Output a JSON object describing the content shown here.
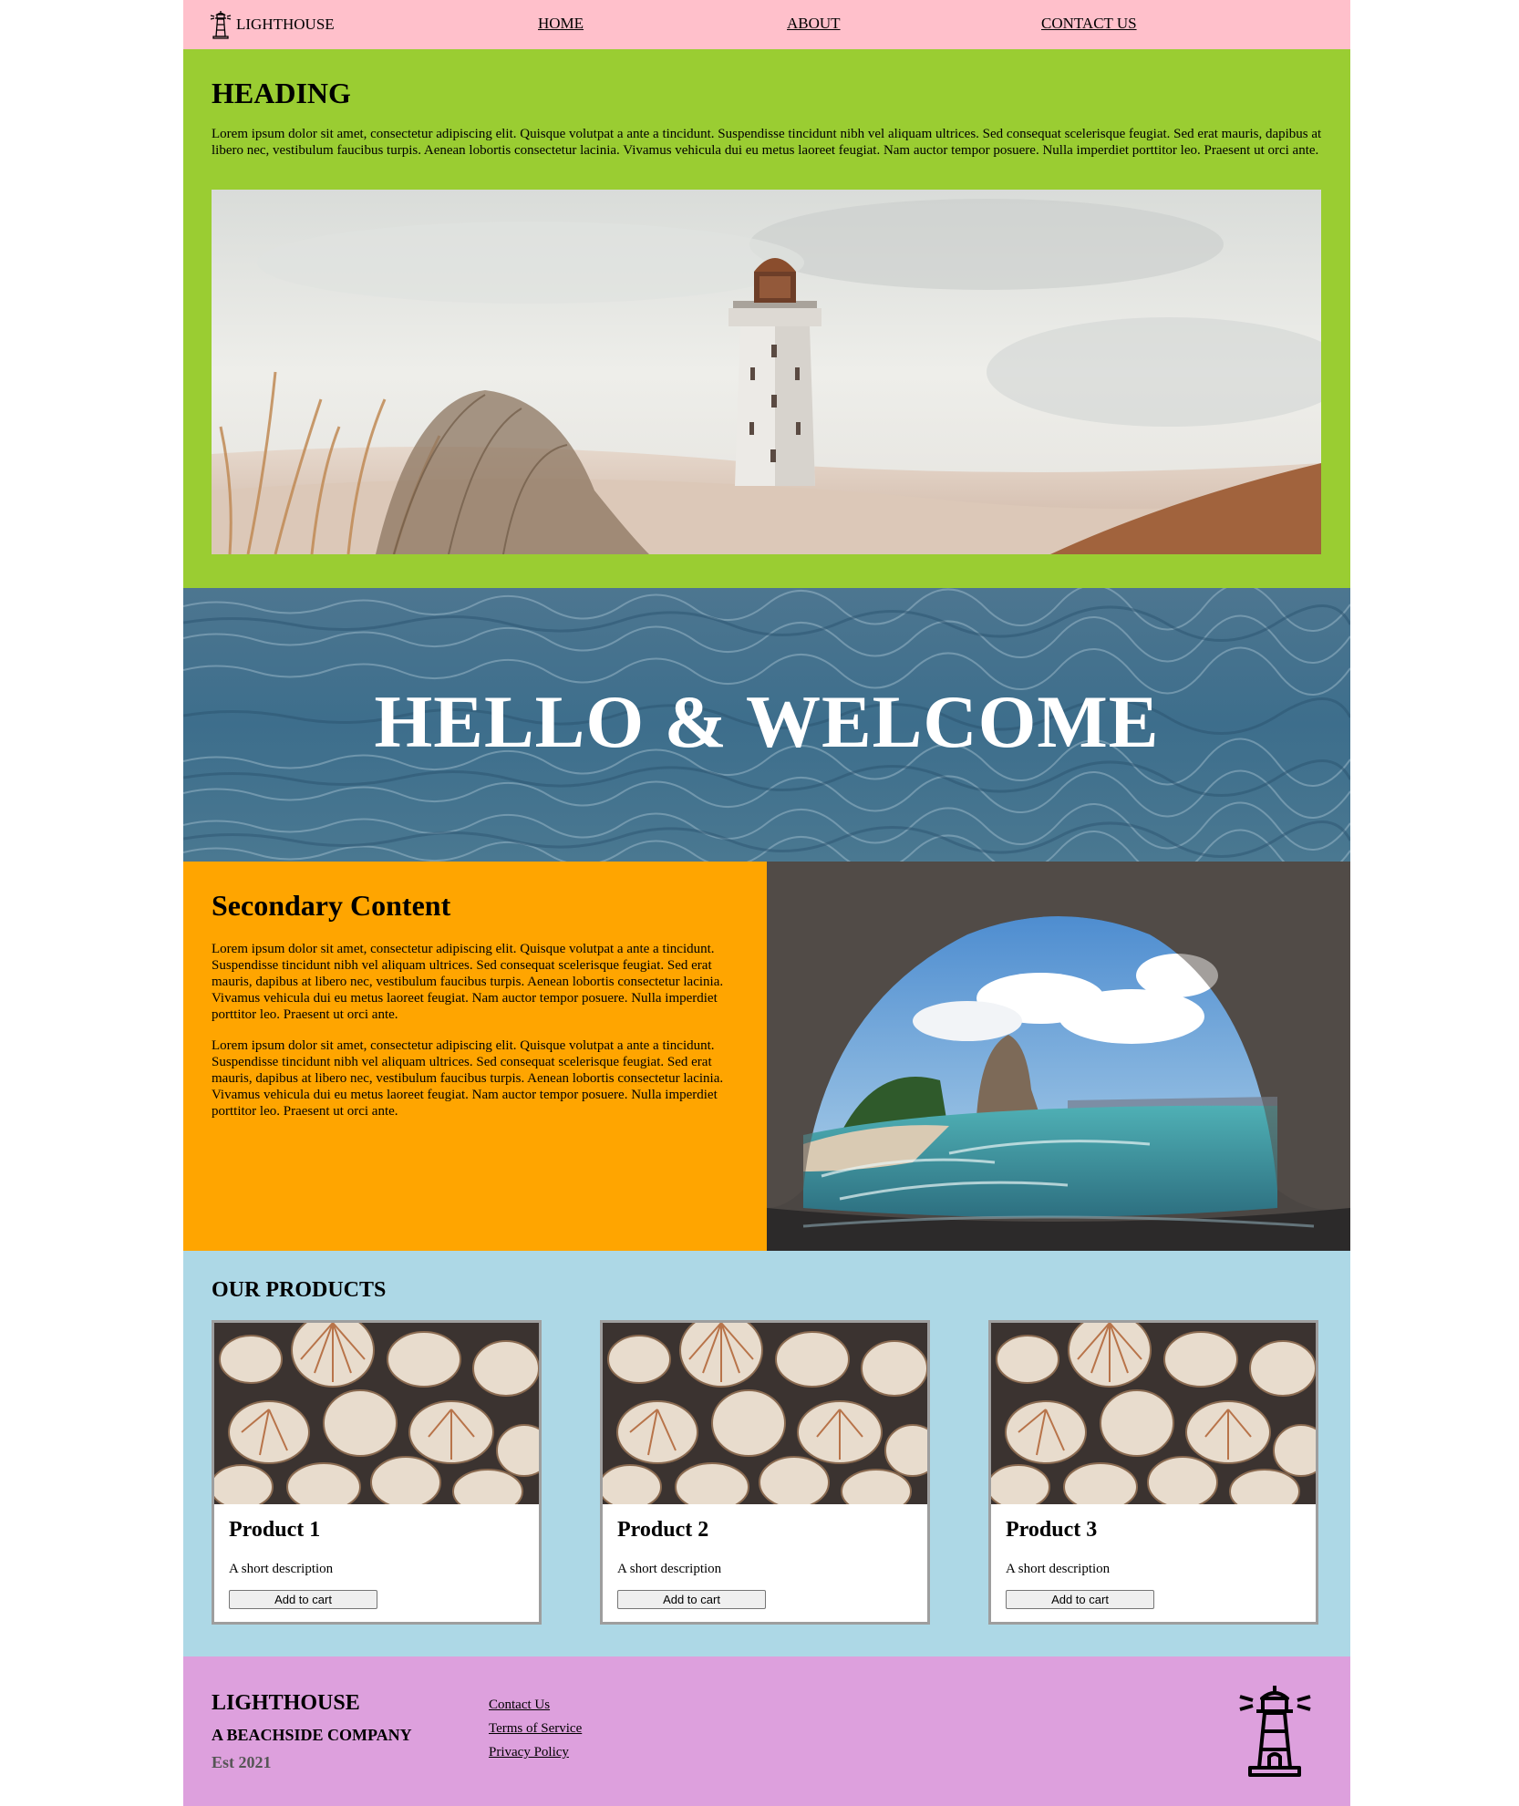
{
  "nav": {
    "brand": "LIGHTHOUSE",
    "links": [
      "HOME",
      "ABOUT",
      "CONTACT US"
    ]
  },
  "intro": {
    "heading": "HEADING",
    "body": "Lorem ipsum dolor sit amet, consectetur adipiscing elit. Quisque volutpat a ante a tincidunt. Suspendisse tincidunt nibh vel aliquam ultrices. Sed consequat scelerisque feugiat. Sed erat mauris, dapibus at libero nec, vestibulum faucibus turpis. Aenean lobortis consectetur lacinia. Vivamus vehicula dui eu metus laoreet feugiat. Nam auctor tempor posuere. Nulla imperdiet porttitor leo. Praesent ut orci ante."
  },
  "welcome": {
    "title": "HELLO & WELCOME"
  },
  "secondary": {
    "heading": "Secondary Content",
    "paragraphs": [
      "Lorem ipsum dolor sit amet, consectetur adipiscing elit. Quisque volutpat a ante a tincidunt. Suspendisse tincidunt nibh vel aliquam ultrices. Sed consequat scelerisque feugiat. Sed erat mauris, dapibus at libero nec, vestibulum faucibus turpis. Aenean lobortis consectetur lacinia. Vivamus vehicula dui eu metus laoreet feugiat. Nam auctor tempor posuere. Nulla imperdiet porttitor leo. Praesent ut orci ante.",
      "Lorem ipsum dolor sit amet, consectetur adipiscing elit. Quisque volutpat a ante a tincidunt. Suspendisse tincidunt nibh vel aliquam ultrices. Sed consequat scelerisque feugiat. Sed erat mauris, dapibus at libero nec, vestibulum faucibus turpis. Aenean lobortis consectetur lacinia. Vivamus vehicula dui eu metus laoreet feugiat. Nam auctor tempor posuere. Nulla imperdiet porttitor leo. Praesent ut orci ante."
    ]
  },
  "products": {
    "heading": "OUR PRODUCTS",
    "items": [
      {
        "name": "Product 1",
        "description": "A short description",
        "button": "Add to cart"
      },
      {
        "name": "Product 2",
        "description": "A short description",
        "button": "Add to cart"
      },
      {
        "name": "Product 3",
        "description": "A short description",
        "button": "Add to cart"
      }
    ]
  },
  "footer": {
    "brand": "LIGHTHOUSE",
    "tagline": "A BEACHSIDE COMPANY",
    "established": "Est 2021",
    "links": [
      "Contact Us",
      "Terms of Service",
      "Privacy Policy"
    ]
  },
  "colors": {
    "nav_bg": "#ffc0cb",
    "intro_bg": "#9acd32",
    "secondary_bg": "#ffa500",
    "products_bg": "#add8e6",
    "footer_bg": "#dda0dd"
  },
  "icons": [
    "lighthouse-icon",
    "lighthouse-logo-icon"
  ]
}
